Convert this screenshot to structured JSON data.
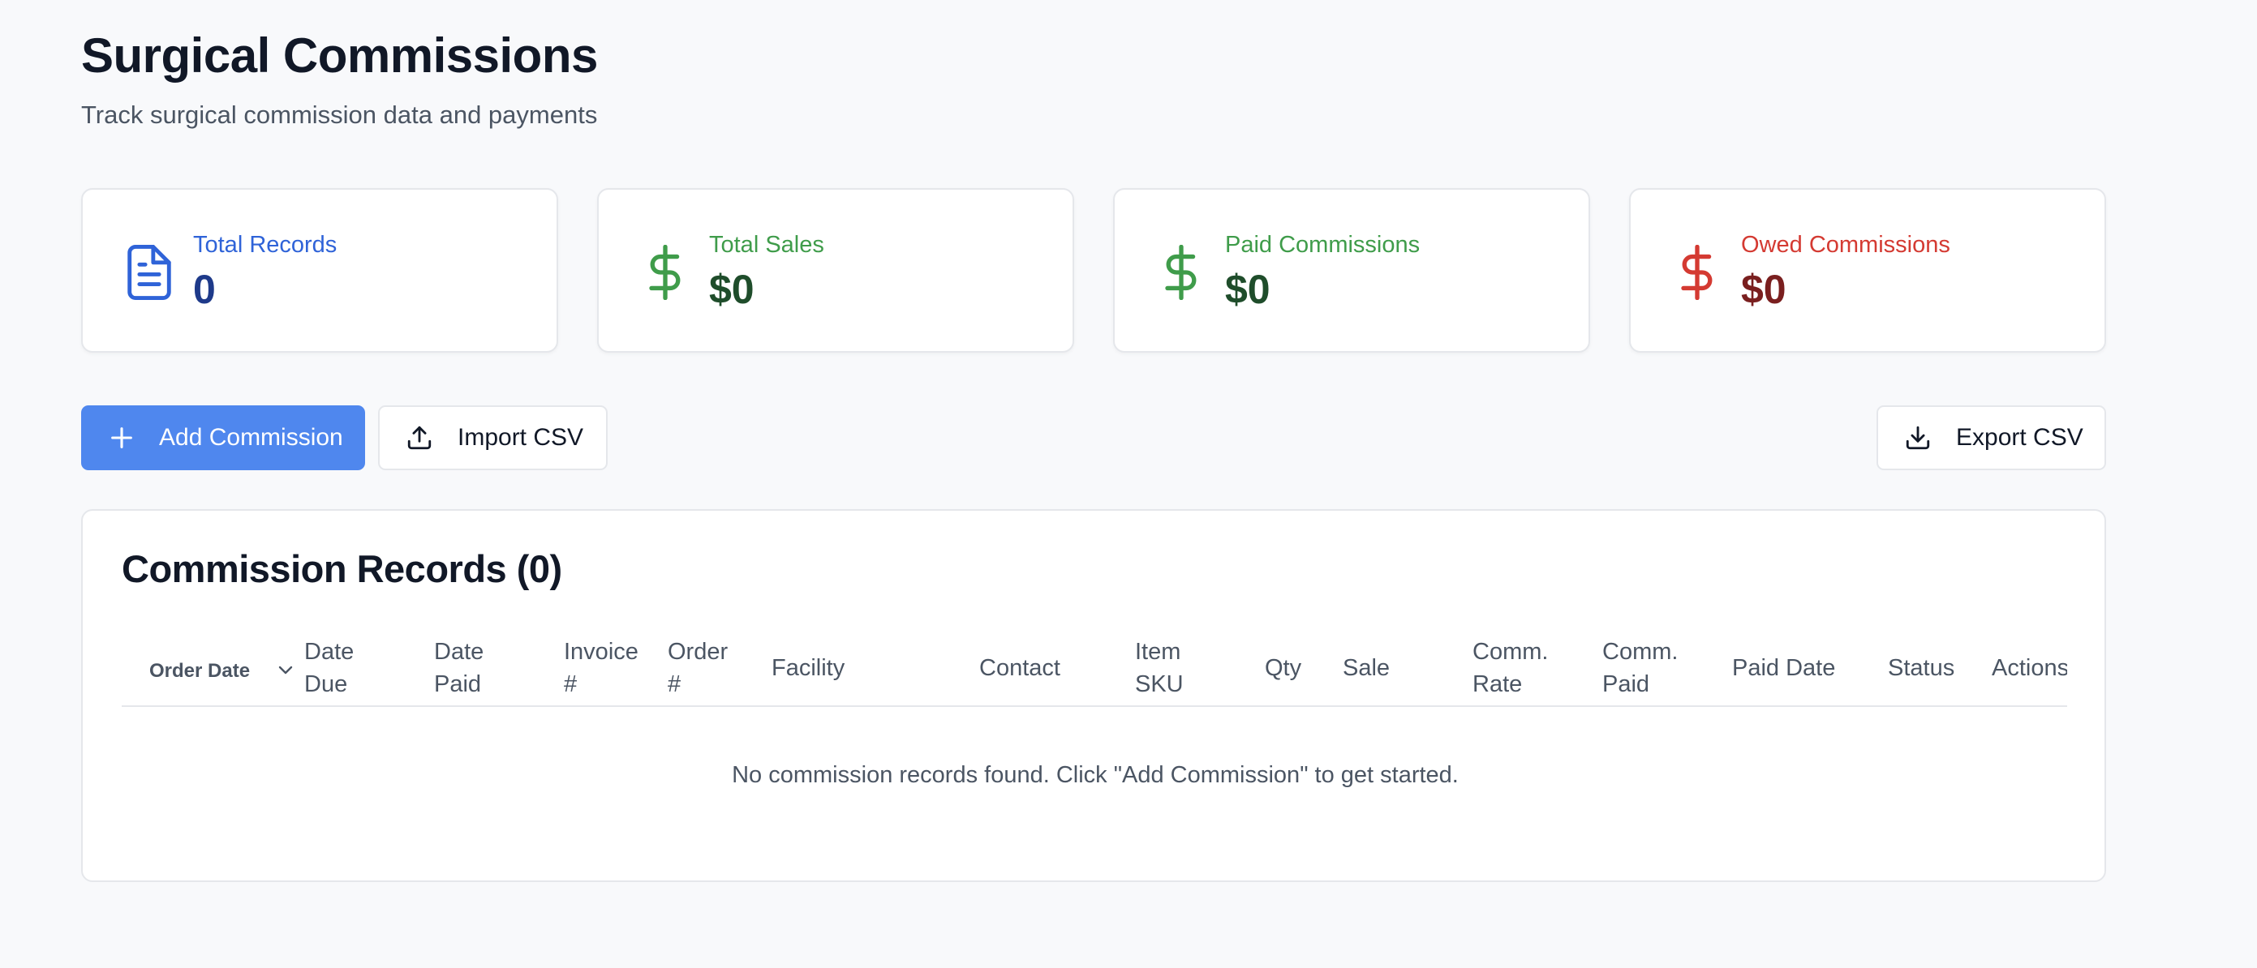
{
  "header": {
    "title": "Surgical Commissions",
    "subtitle": "Track surgical commission data and payments"
  },
  "stats": [
    {
      "label": "Total Records",
      "value": "0",
      "icon": "document-icon",
      "label_color": "#2f63d8",
      "value_color": "#1e3a8a"
    },
    {
      "label": "Total Sales",
      "value": "$0",
      "icon": "dollar-icon",
      "label_color": "#3f9c4a",
      "value_color": "#1f4d2b"
    },
    {
      "label": "Paid Commissions",
      "value": "$0",
      "icon": "dollar-icon",
      "label_color": "#3f9c4a",
      "value_color": "#1f4d2b"
    },
    {
      "label": "Owed Commissions",
      "value": "$0",
      "icon": "dollar-icon",
      "label_color": "#d43a32",
      "value_color": "#7a1f1f"
    }
  ],
  "toolbar": {
    "add_label": "Add Commission",
    "import_label": "Import CSV",
    "export_label": "Export CSV"
  },
  "table": {
    "title": "Commission Records (0)",
    "columns": [
      {
        "line1": "Order Date",
        "line2": ""
      },
      {
        "line1": "Date",
        "line2": "Due"
      },
      {
        "line1": "Date",
        "line2": "Paid"
      },
      {
        "line1": "Invoice",
        "line2": "#"
      },
      {
        "line1": "Order",
        "line2": "#"
      },
      {
        "line1": "Facility",
        "line2": ""
      },
      {
        "line1": "Contact",
        "line2": ""
      },
      {
        "line1": "Item",
        "line2": "SKU"
      },
      {
        "line1": "Qty",
        "line2": ""
      },
      {
        "line1": "Sale",
        "line2": ""
      },
      {
        "line1": "Comm.",
        "line2": "Rate"
      },
      {
        "line1": "Comm.",
        "line2": "Paid"
      },
      {
        "line1": "Paid Date",
        "line2": ""
      },
      {
        "line1": "Status",
        "line2": ""
      },
      {
        "line1": "Actions",
        "line2": ""
      }
    ],
    "empty_message": "No commission records found. Click \"Add Commission\" to get started."
  },
  "colors": {
    "primary": "#4f87ee",
    "background": "#f8f9fb",
    "border": "#e5e7eb"
  }
}
